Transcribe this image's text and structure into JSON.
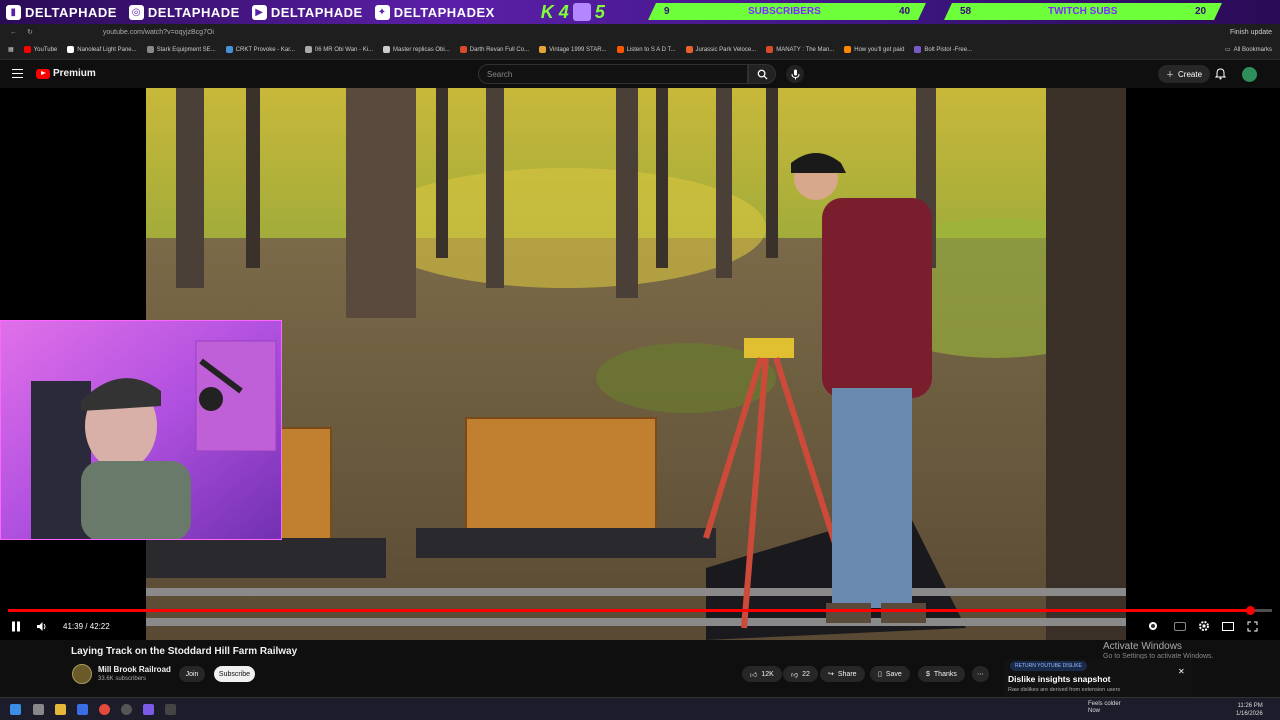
{
  "stream_overlay": {
    "socials": [
      {
        "icon": "twitch-icon",
        "handle": "DELTAPHADE"
      },
      {
        "icon": "instagram-icon",
        "handle": "DELTAPHADE"
      },
      {
        "icon": "youtube-icon",
        "handle": "DELTAPHADE"
      },
      {
        "icon": "twitter-icon",
        "handle": "DELTAPHADEX"
      }
    ],
    "k4_text": "K 4",
    "k4_count": "5",
    "subscriber_goal": {
      "current": "9",
      "label": "SUBSCRIBERS",
      "target": "40"
    },
    "twitch_goal": {
      "current": "58",
      "label": "TWITCH SUBS",
      "target": "20"
    }
  },
  "browser": {
    "url": "youtube.com/watch?v=oqyjzBcg7Oi",
    "finish_update": "Finish update",
    "bookmarks": [
      {
        "label": "YouTube",
        "color": "#ff0000"
      },
      {
        "label": "Nanoleaf Light Pane...",
        "color": "#ffffff"
      },
      {
        "label": "Stark Equipment SE...",
        "color": "#888888"
      },
      {
        "label": "CRKT Provoke - Kar...",
        "color": "#4a90d9"
      },
      {
        "label": "06 MR Obi Wan - Ki...",
        "color": "#aaaaaa"
      },
      {
        "label": "Master replicas Obi...",
        "color": "#cccccc"
      },
      {
        "label": "Darth Revan Full Co...",
        "color": "#d94a2a"
      },
      {
        "label": "Vintage 1999 STAR...",
        "color": "#e5a33a"
      },
      {
        "label": "Listen to S A D T...",
        "color": "#ff5500"
      },
      {
        "label": "Jurassic Park Veloce...",
        "color": "#e5632a"
      },
      {
        "label": "MANATY : The Man...",
        "color": "#d94a2a"
      },
      {
        "label": "How you'll get paid",
        "color": "#ff8800"
      },
      {
        "label": "Bolt Pistol -Free...",
        "color": "#7a5ac8"
      }
    ],
    "all_bookmarks": "All Bookmarks"
  },
  "youtube": {
    "brand": "Premium",
    "search_placeholder": "Search",
    "create_label": "Create"
  },
  "player": {
    "current_time": "41:39",
    "duration": "42:22",
    "time_display": "41:39 / 42:22",
    "progress": 0.983
  },
  "video": {
    "title": "Laying Track on the Stoddard Hill Farm Railway",
    "channel": "Mill Brook Railroad",
    "subscribers": "33.6K subscribers",
    "join_label": "Join",
    "subscribe_label": "Subscribe",
    "likes": "12K",
    "dislikes": "22",
    "share_label": "Share",
    "save_label": "Save",
    "thanks_label": "Thanks"
  },
  "activate_windows": {
    "title": "Activate Windows",
    "subtitle": "Go to Settings to activate Windows."
  },
  "dislike_panel": {
    "badge": "RETURN YOUTUBE DISLIKE",
    "title": "Dislike insights snapshot",
    "subtitle": "Raw dislikes are derived from extension users"
  },
  "taskbar": {
    "weather_title": "Feels colder",
    "weather_sub": "Now",
    "time": "11:26 PM",
    "date": "1/16/2026"
  },
  "colors": {
    "accent_red": "#ff0000",
    "overlay_purple": "#5b1fa8",
    "overlay_green": "#6cff3a"
  }
}
